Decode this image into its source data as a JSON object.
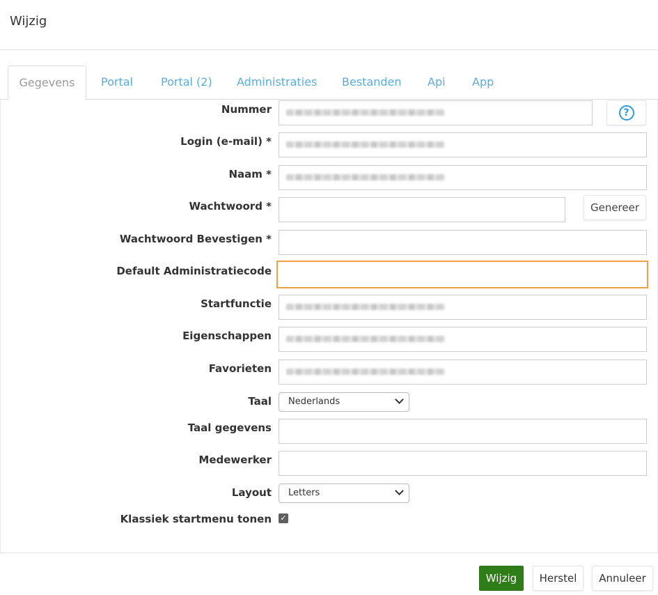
{
  "dialog": {
    "title": "Wijzig"
  },
  "tabs": [
    {
      "label": "Gegevens",
      "active": true
    },
    {
      "label": "Portal"
    },
    {
      "label": "Portal (2)"
    },
    {
      "label": "Administraties"
    },
    {
      "label": "Bestanden"
    },
    {
      "label": "Api"
    },
    {
      "label": "App"
    }
  ],
  "form": {
    "nummer_label": "Nummer",
    "login_label": "Login (e-mail) *",
    "naam_label": "Naam *",
    "wachtwoord_label": "Wachtwoord *",
    "genereer_label": "Genereer",
    "wachtwoord_bevestigen_label": "Wachtwoord Bevestigen *",
    "default_admin_label": "Default Administratiecode",
    "startfunctie_label": "Startfunctie",
    "eigenschappen_label": "Eigenschappen",
    "favorieten_label": "Favorieten",
    "taal_label": "Taal",
    "taal_value": "Nederlands",
    "taal_gegevens_label": "Taal gegevens",
    "medewerker_label": "Medewerker",
    "layout_label": "Layout",
    "layout_value": "Letters",
    "klassiek_label": "Klassiek startmenu tonen",
    "klassiek_checked": true
  },
  "icons": {
    "help": "help-circle-icon",
    "chevron": "chevron-down-icon",
    "check": "check-icon"
  },
  "footer": {
    "wijzig_label": "Wijzig",
    "herstel_label": "Herstel",
    "annuleer_label": "Annuleer"
  },
  "colors": {
    "accent": "#5aace0",
    "primary_button": "#2e7d18",
    "focus_border": "#f0a040",
    "help_icon": "#2a9be0"
  }
}
